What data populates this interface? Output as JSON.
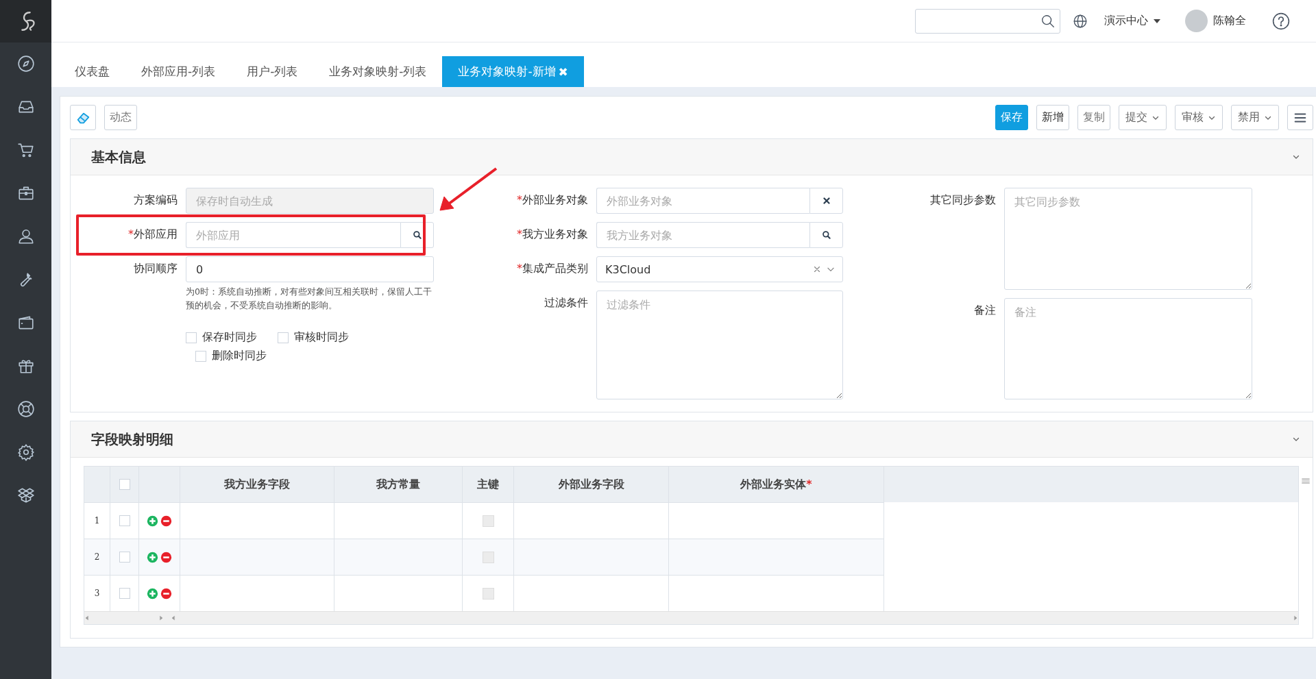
{
  "topbar": {
    "org": "演示中心",
    "user": "陈翰全"
  },
  "tabs": [
    {
      "label": "仪表盘",
      "selected": false
    },
    {
      "label": "外部应用-列表",
      "selected": false
    },
    {
      "label": "用户-列表",
      "selected": false
    },
    {
      "label": "业务对象映射-列表",
      "selected": false
    },
    {
      "label": "业务对象映射-新增",
      "selected": true,
      "close": "✖"
    }
  ],
  "toolbar": {
    "left": [
      {
        "label": "动态"
      }
    ],
    "right": [
      {
        "label": "保存",
        "kind": "primary"
      },
      {
        "label": "新增",
        "kind": "plain"
      },
      {
        "label": "复制",
        "kind": "muted"
      },
      {
        "label": "提交",
        "kind": "dropdown"
      },
      {
        "label": "审核",
        "kind": "dropdown"
      },
      {
        "label": "禁用",
        "kind": "dropdown"
      }
    ]
  },
  "basic_info": {
    "title": "基本信息",
    "columns": [
      [
        {
          "label": "方案编码",
          "kind": "text",
          "disabled": true,
          "placeholder": "保存时自动生成"
        },
        {
          "label": "外部应用",
          "required_mark": "*",
          "kind": "lookup",
          "placeholder": "外部应用",
          "highlighted": true
        },
        {
          "label": "协同顺序",
          "kind": "text",
          "disabled": false,
          "value": "0",
          "hint": "为0时：系统自动推断，对有些对象间互相关联时，保留人工干预的机会，不受系统自动推断的影响。"
        },
        {
          "kind": "checkboxes",
          "items": [
            {
              "label": "保存时同步",
              "checked": false
            },
            {
              "label": "审核时同步",
              "checked": false
            },
            {
              "label": "删除时同步",
              "checked": false
            }
          ]
        }
      ],
      [
        {
          "label": "外部业务对象",
          "required_mark": "*",
          "kind": "clearable",
          "placeholder": "外部业务对象"
        },
        {
          "label": "我方业务对象",
          "required_mark": "*",
          "kind": "lookup",
          "placeholder": "我方业务对象"
        },
        {
          "label": "集成产品类别",
          "required_mark": "*",
          "kind": "select",
          "value": "K3Cloud"
        },
        {
          "label": "过滤条件",
          "kind": "textarea",
          "placeholder": "过滤条件"
        }
      ],
      [
        {
          "label": "其它同步参数",
          "kind": "textarea",
          "placeholder": "其它同步参数"
        },
        {
          "label": "备注",
          "kind": "textarea",
          "placeholder": "备注"
        }
      ]
    ]
  },
  "field_mapping": {
    "title": "字段映射明细",
    "select_all_checked": false,
    "columns": [
      {
        "label": "我方业务字段"
      },
      {
        "label": "我方常量"
      },
      {
        "label": "主键"
      },
      {
        "label": "外部业务字段"
      },
      {
        "label": "外部业务实体",
        "required_mark": "*"
      }
    ],
    "rows": [
      {
        "number": "1",
        "selected": false,
        "primary_key": false
      },
      {
        "number": "2",
        "selected": false,
        "primary_key": false
      },
      {
        "number": "3",
        "selected": false,
        "primary_key": false
      }
    ]
  }
}
